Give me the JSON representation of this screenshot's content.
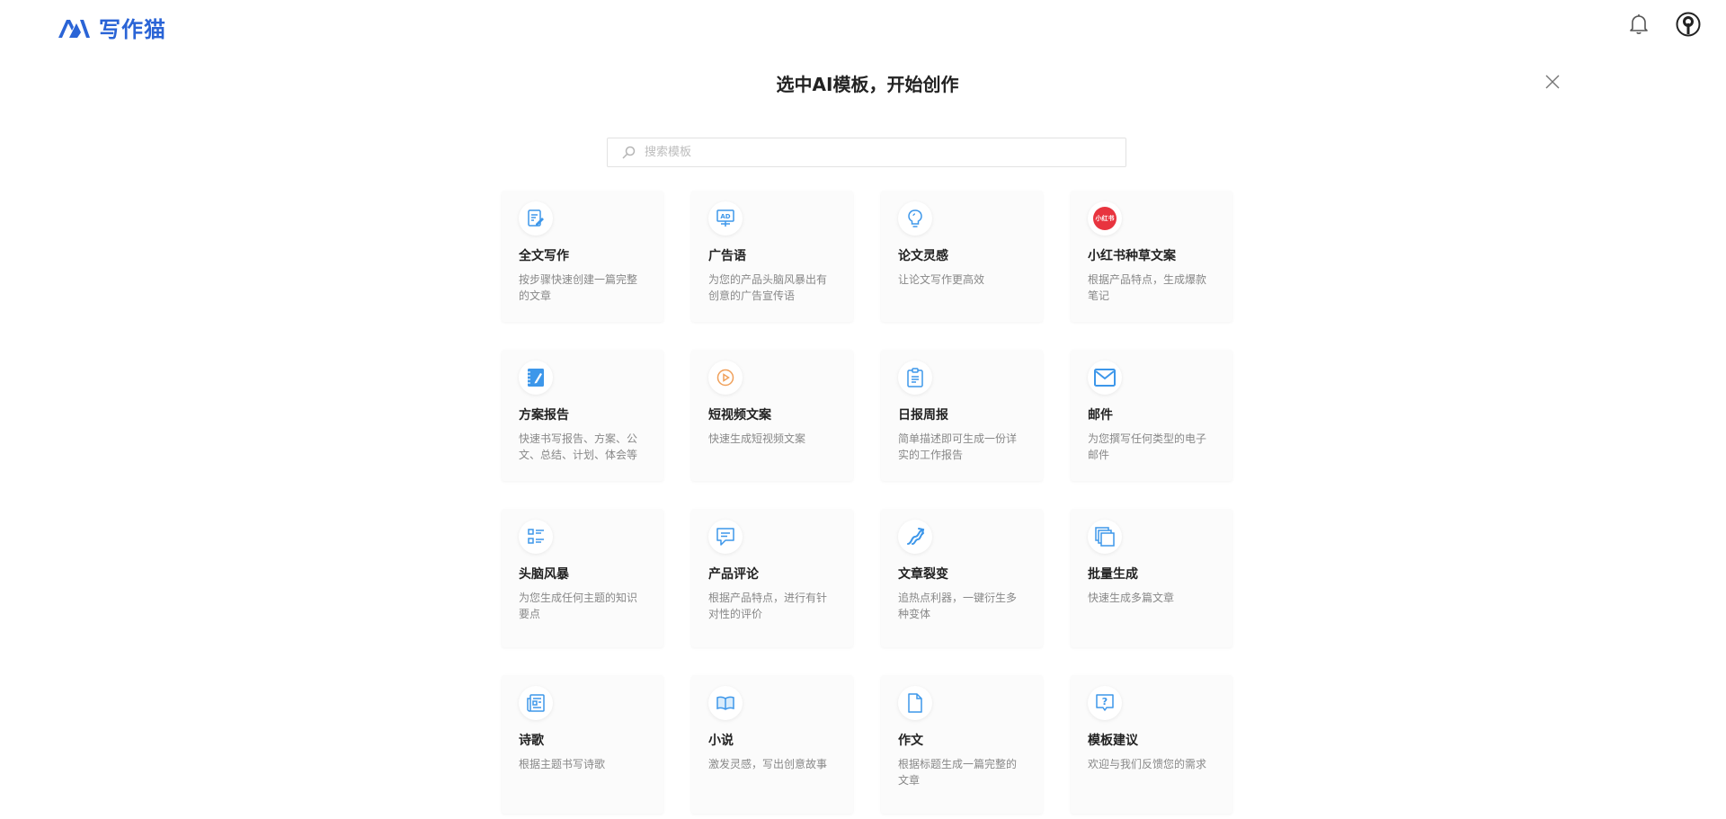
{
  "app": {
    "logo_text": "写作猫"
  },
  "modal": {
    "title": "选中AI模板，开始创作",
    "search_placeholder": "搜索模板"
  },
  "colors": {
    "accent": "#2a64d6",
    "icon_blue": "#4da3ee",
    "xhs_red": "#e8343f",
    "video_orange": "#f0a05a"
  },
  "templates": [
    {
      "title": "全文写作",
      "desc": "按步骤快速创建一篇完整的文章",
      "icon": "edit-doc-icon"
    },
    {
      "title": "广告语",
      "desc": "为您的产品头脑风暴出有创意的广告宣传语",
      "icon": "ad-board-icon"
    },
    {
      "title": "论文灵感",
      "desc": "让论文写作更高效",
      "icon": "lightbulb-icon"
    },
    {
      "title": "小红书种草文案",
      "desc": "根据产品特点，生成爆款笔记",
      "icon": "xiaohongshu-icon",
      "icon_text": "小红书"
    },
    {
      "title": "方案报告",
      "desc": "快速书写报告、方案、公文、总结、计划、体会等",
      "icon": "notebook-icon"
    },
    {
      "title": "短视频文案",
      "desc": "快速生成短视频文案",
      "icon": "play-icon"
    },
    {
      "title": "日报周报",
      "desc": "简单描述即可生成一份详实的工作报告",
      "icon": "clipboard-icon"
    },
    {
      "title": "邮件",
      "desc": "为您撰写任何类型的电子邮件",
      "icon": "mail-icon"
    },
    {
      "title": "头脑风暴",
      "desc": "为您生成任何主题的知识要点",
      "icon": "list-icon"
    },
    {
      "title": "产品评论",
      "desc": "根据产品特点，进行有针对性的评价",
      "icon": "comment-icon"
    },
    {
      "title": "文章裂变",
      "desc": "追热点利器，一键衍生多种变体",
      "icon": "split-arrow-icon"
    },
    {
      "title": "批量生成",
      "desc": "快速生成多篇文章",
      "icon": "stack-copy-icon"
    },
    {
      "title": "诗歌",
      "desc": "根据主题书写诗歌",
      "icon": "newspaper-icon"
    },
    {
      "title": "小说",
      "desc": "激发灵感，写出创意故事",
      "icon": "book-icon"
    },
    {
      "title": "作文",
      "desc": "根据标题生成一篇完整的文章",
      "icon": "document-icon"
    },
    {
      "title": "模板建议",
      "desc": "欢迎与我们反馈您的需求",
      "icon": "question-icon"
    }
  ]
}
